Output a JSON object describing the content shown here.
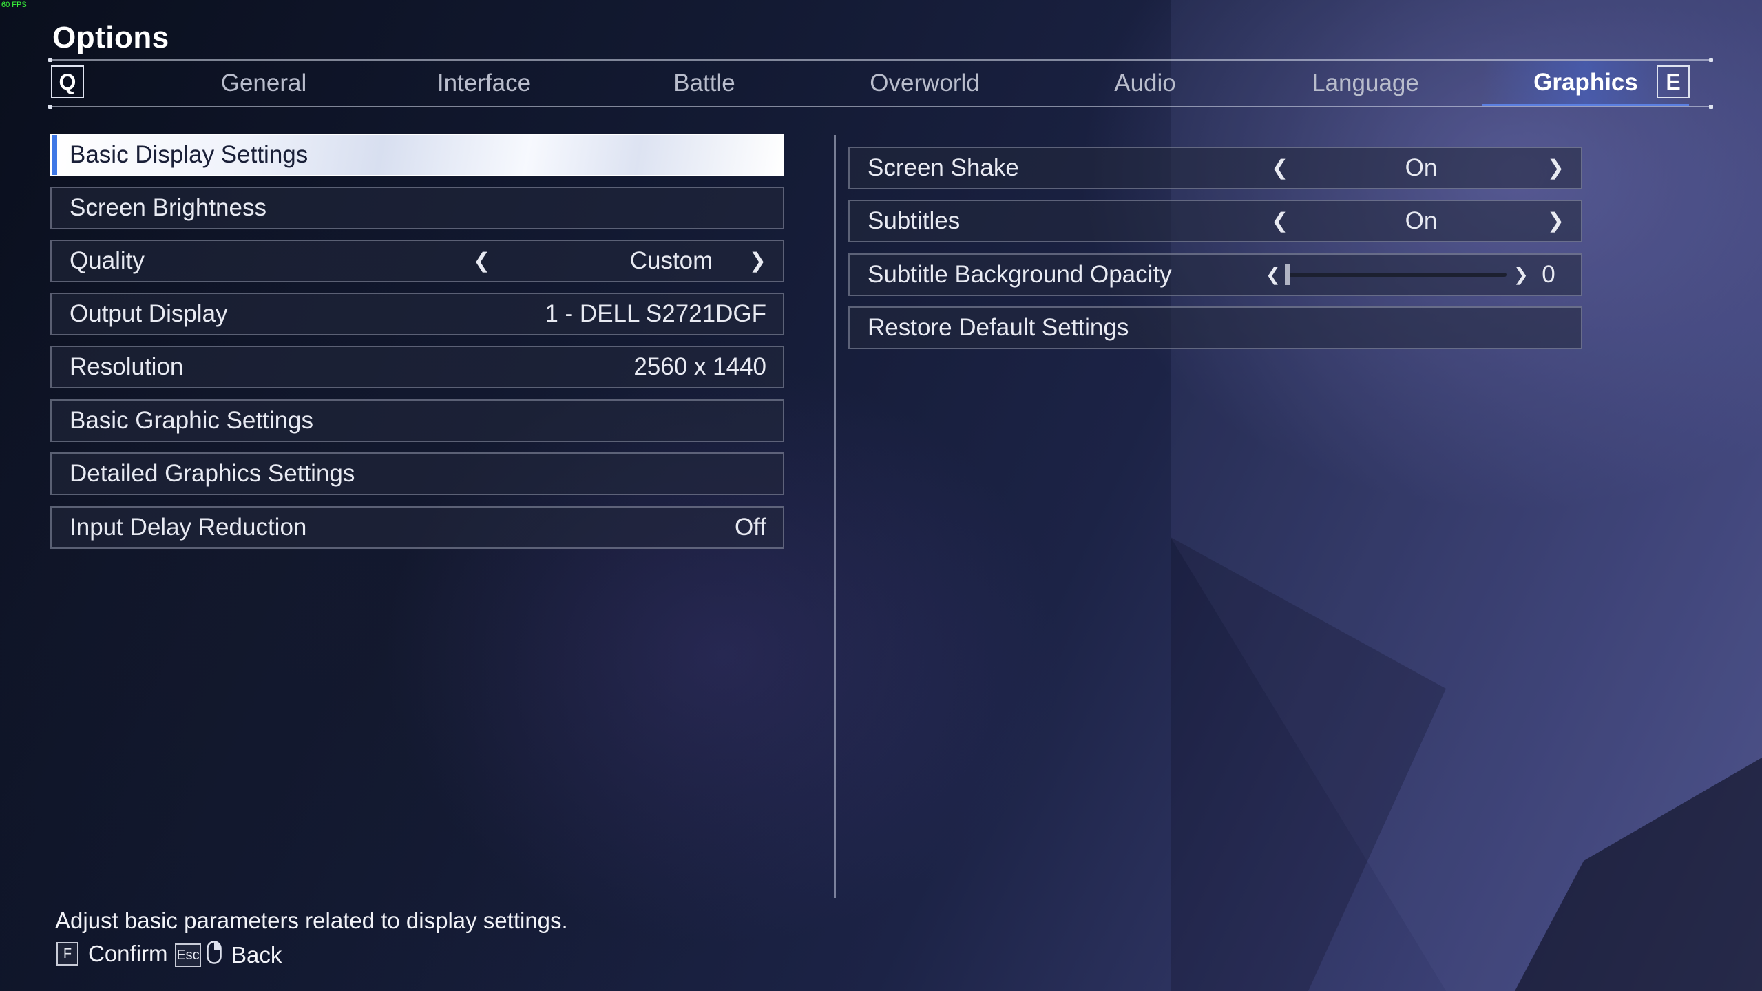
{
  "hud": {
    "fps": "60 FPS"
  },
  "header": {
    "title": "Options"
  },
  "tabs": {
    "prev_key": "Q",
    "next_key": "E",
    "items": [
      {
        "label": "General"
      },
      {
        "label": "Interface"
      },
      {
        "label": "Battle"
      },
      {
        "label": "Overworld"
      },
      {
        "label": "Audio"
      },
      {
        "label": "Language"
      },
      {
        "label": "Graphics"
      }
    ],
    "active": "Graphics"
  },
  "left_panel": {
    "basic_display": "Basic Display Settings",
    "screen_brightness": "Screen Brightness",
    "quality": {
      "label": "Quality",
      "value": "Custom"
    },
    "output_display": {
      "label": "Output Display",
      "value": "1 - DELL S2721DGF"
    },
    "resolution": {
      "label": "Resolution",
      "value": "2560 x 1440"
    },
    "basic_graphic": "Basic Graphic Settings",
    "detailed_graphics": "Detailed Graphics Settings",
    "input_delay": {
      "label": "Input Delay Reduction",
      "value": "Off"
    }
  },
  "right_panel": {
    "screen_shake": {
      "label": "Screen Shake",
      "value": "On"
    },
    "subtitles": {
      "label": "Subtitles",
      "value": "On"
    },
    "subtitle_bg_opacity": {
      "label": "Subtitle Background Opacity",
      "value": "0",
      "level": 0
    },
    "restore_defaults": "Restore Default Settings"
  },
  "footer": {
    "description": "Adjust basic parameters related to display settings.",
    "confirm_key": "F",
    "confirm_label": "Confirm",
    "back_key": "Esc",
    "back_label": "Back",
    "back_icon": "mouse-icon"
  },
  "colors": {
    "accent": "#3f78e6",
    "active_tab": "#5b7fe0",
    "fps": "#3cff3c"
  }
}
